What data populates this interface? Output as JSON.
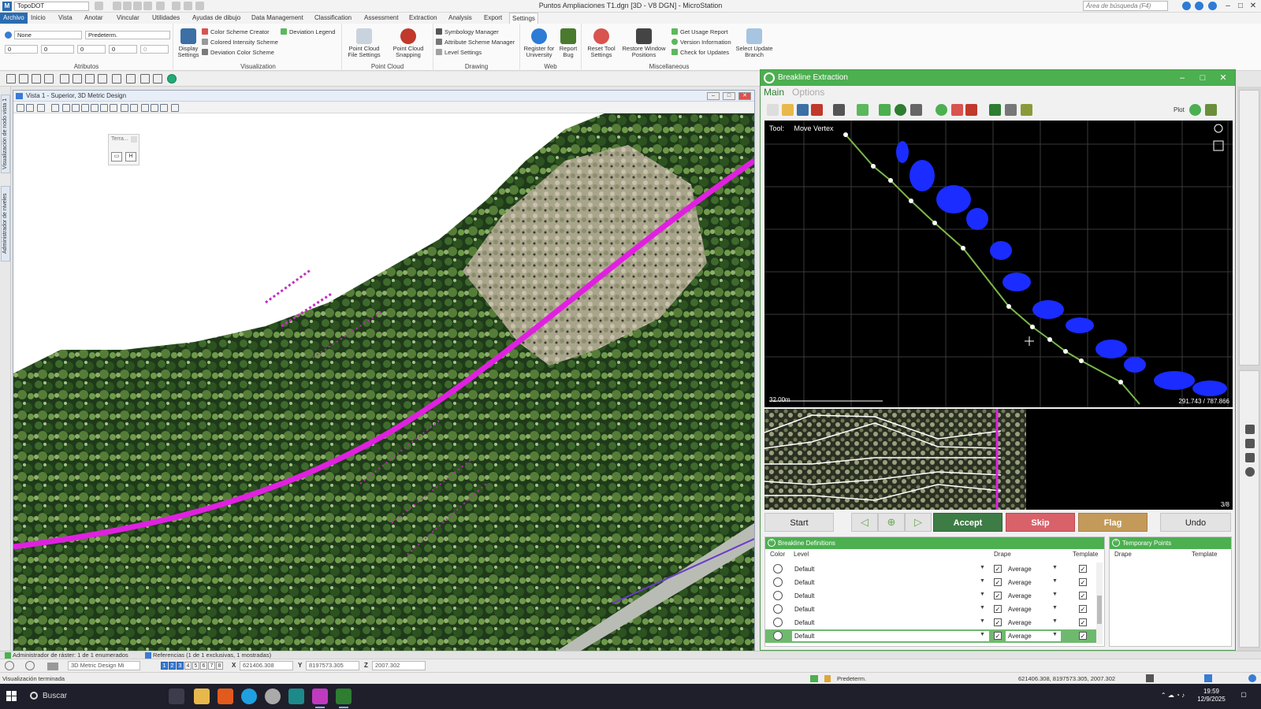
{
  "app": {
    "workspace": "TopoDOT",
    "title": "Puntos Ampliaciones T1.dgn [3D - V8 DGN] - MicroStation",
    "search_placeholder": "Área de búsqueda (F4)",
    "brand_color": "#2b6cb0"
  },
  "tabs": [
    "Archivo",
    "Inicio",
    "Vista",
    "Anotar",
    "Vincular",
    "Utilidades",
    "Ayudas de dibujo",
    "Data Management",
    "Classification",
    "Assessment",
    "Extraction",
    "Analysis",
    "Export",
    "Settings"
  ],
  "active_tab": "Settings",
  "ribbon": {
    "attributes": {
      "label": "Atributos",
      "level": "None",
      "style": "Predeterm.",
      "color_value": "0",
      "line_style_value": "0",
      "weight_value": "0",
      "class_value": "0",
      "transparency_value": "0"
    },
    "visualization": {
      "label": "Visualization",
      "display_settings": "Display Settings",
      "color_scheme_creator": "Color Scheme Creator",
      "colored_intensity_scheme": "Colored Intensity Scheme",
      "deviation_color_scheme": "Deviation Color Scheme",
      "deviation_legend": "Deviation Legend"
    },
    "point_cloud": {
      "label": "Point Cloud",
      "file_settings": "Point Cloud File Settings",
      "snapping": "Point Cloud Snapping"
    },
    "drawing": {
      "label": "Drawing",
      "symbology_manager": "Symbology Manager",
      "attribute_scheme_manager": "Attribute Scheme Manager",
      "level_settings": "Level Settings"
    },
    "web": {
      "label": "Web",
      "register": "Register for University",
      "report_bug": "Report Bug"
    },
    "misc": {
      "label": "Miscellaneous",
      "reset_tool": "Reset Tool Settings",
      "restore_window": "Restore Window Positions",
      "usage_report": "Get Usage Report",
      "version_info": "Version Information",
      "check_updates": "Check for Updates",
      "update_branch": "Select Update Branch"
    }
  },
  "left_tabs": [
    "Visualización de nodo vista 1",
    "Administrador de niveles"
  ],
  "view": {
    "title": "Vista 1 - Superior, 3D Metric Design",
    "mini_panel_title": "Terra...",
    "mini_tool_1": "▭",
    "mini_tool_2": "H"
  },
  "breakline": {
    "title": "Breakline Extraction",
    "tab_main": "Main",
    "tab_options": "Options",
    "plot_label": "Plot",
    "tool_label": "Tool:",
    "tool_value": "Move Vertex",
    "scale_text": "32.00m",
    "coord_text": "291.743 / 787.866",
    "page_count": "3/8",
    "buttons": {
      "start": "Start",
      "accept": "Accept",
      "skip": "Skip",
      "flag": "Flag",
      "undo": "Undo"
    },
    "definitions": {
      "title": "Breakline Definitions",
      "columns": [
        "Color",
        "Level",
        "Drape",
        "Template"
      ],
      "rows": [
        {
          "level": "Default",
          "drape": "Average"
        },
        {
          "level": "Default",
          "drape": "Average"
        },
        {
          "level": "Default",
          "drape": "Average"
        },
        {
          "level": "Default",
          "drape": "Average"
        },
        {
          "level": "Default",
          "drape": "Average"
        },
        {
          "level": "Default",
          "drape": "Average"
        }
      ],
      "selected_row_color": "#6fb96f"
    },
    "temporary": {
      "title": "Temporary Points",
      "columns": [
        "Drape",
        "Template"
      ]
    },
    "accent_color": "#4caf50"
  },
  "reference_bar": {
    "raster": "Administrador de ráster: 1 de 1 enumerados",
    "references": "Referencias (1 de 1 exclusivas, 1 mostradas)"
  },
  "coord_bar": {
    "model": "3D Metric Design Mi",
    "views": [
      "1",
      "2",
      "3",
      "4",
      "5",
      "6",
      "7",
      "8"
    ],
    "x_label": "X",
    "x_value": "621406.308",
    "y_label": "Y",
    "y_value": "8197573.305",
    "z_label": "Z",
    "z_value": "2007.302"
  },
  "status_bar": {
    "message": "Visualización terminada",
    "level": "Predeterm.",
    "coords": "621406.308, 8197573.305, 2007.302"
  },
  "taskbar": {
    "search": "Buscar",
    "time": "19:59",
    "date": "12/9/2025"
  }
}
